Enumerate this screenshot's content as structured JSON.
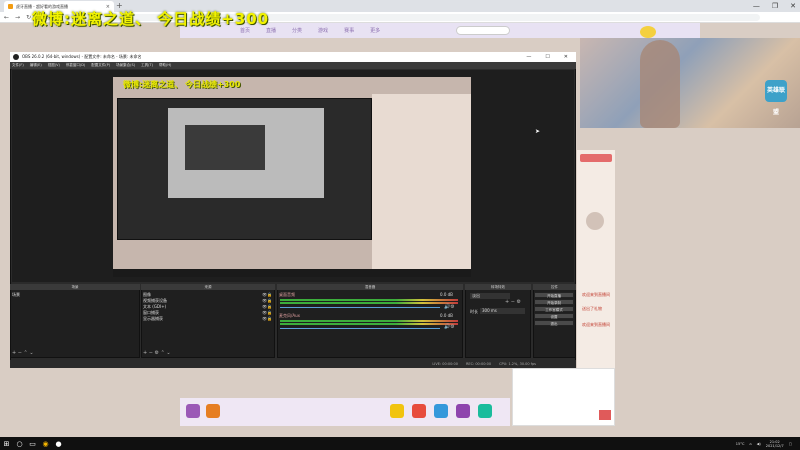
{
  "browser": {
    "tab_title": "虎牙直播 - 超好看的游戏直播",
    "new_tab": "+",
    "controls": [
      "—",
      "❐",
      "✕"
    ],
    "address": "huya.com"
  },
  "overlay": {
    "text": "微博:迷离之道、 今日战绩+300"
  },
  "page": {
    "nav": [
      "首页",
      "直播",
      "分类",
      "游戏",
      "赛事",
      "更多"
    ],
    "chat_lines": [
      "欢迎来到直播间",
      "送出了礼物",
      "欢迎来到直播间",
      "送出了礼物",
      "欢迎来到直播间",
      "欢迎来到直播间"
    ],
    "banner_logo": "英雄联盟"
  },
  "obs": {
    "title": "OBS 26.0.2 (64-bit, windows) - 配置文件: 未命名 - 场景: 未命名",
    "menu": [
      "文件(F)",
      "编辑(E)",
      "视图(V)",
      "停靠窗口(D)",
      "配置文件(P)",
      "场景集合(S)",
      "工具(T)",
      "帮助(H)"
    ],
    "preview_overlay": "微博:迷离之道、 今日战绩+300",
    "docks": {
      "scenes_title": "场景",
      "scenes": [
        "场景"
      ],
      "sources_title": "来源",
      "sources": [
        "图像",
        "视频捕获设备",
        "文本 (GDI+)",
        "窗口捕获",
        "显示器捕获"
      ],
      "mixer_title": "混音器",
      "mixer": [
        {
          "name": "桌面音频",
          "db": "0.0 dB"
        },
        {
          "name": "麦克风/Aux",
          "db": "0.0 dB"
        }
      ],
      "transitions_title": "转场特效",
      "transition_mode": "淡出",
      "duration_label": "时长",
      "duration_value": "300 ms",
      "controls_title": "控件",
      "controls": [
        "开始直播",
        "开始录制",
        "工作室模式",
        "设置",
        "退出"
      ]
    },
    "status": [
      "LIVE: 00:00:00",
      "REC: 00:00:00",
      "CPU: 1.2%, 30.00 fps"
    ]
  },
  "taskbar": {
    "weather": "15°C",
    "time": "21:02",
    "date": "2021/12/7"
  }
}
